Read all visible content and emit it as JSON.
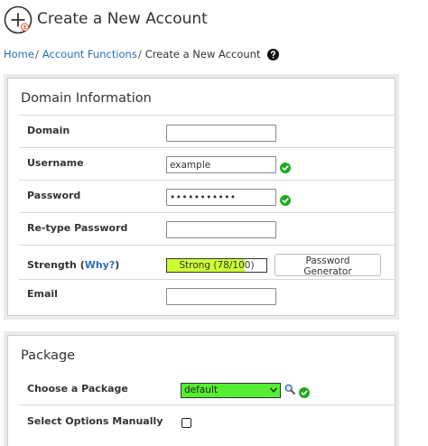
{
  "header": {
    "title": "Create a New Account"
  },
  "breadcrumb": {
    "items": [
      "Home",
      "Account Functions",
      "Create a New Account"
    ],
    "separator": "/"
  },
  "domain_section": {
    "title": "Domain Information",
    "fields": {
      "domain": {
        "label": "Domain",
        "value": ""
      },
      "username": {
        "label": "Username",
        "value": "example"
      },
      "password": {
        "label": "Password",
        "value": "•••••••••••"
      },
      "retype_password": {
        "label": "Re-type Password",
        "value": ""
      },
      "strength": {
        "label_prefix": "Strength (",
        "label_link": "Why?",
        "label_suffix": ")",
        "text": "Strong (78/100)",
        "score": 78,
        "max": 100
      },
      "email": {
        "label": "Email",
        "value": ""
      }
    },
    "password_generator_label": "Password Generator"
  },
  "package_section": {
    "title": "Package",
    "choose_label": "Choose a Package",
    "selected_package": "default",
    "options_label": "Select Options Manually"
  },
  "colors": {
    "link": "#2a6ebb",
    "valid_check": "#22aa22",
    "strength_fill": "#ccff33",
    "package_select": "#55ee33"
  }
}
